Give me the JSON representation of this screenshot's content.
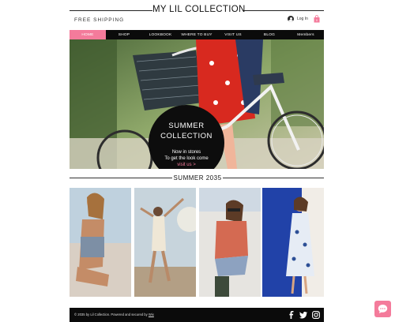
{
  "site": {
    "title": "MY LIL COLLECTION",
    "free_shipping": "FREE SHIPPING",
    "login_label": "Log In"
  },
  "nav": {
    "items": [
      "HOME",
      "SHOP",
      "LOOKBOOK",
      "WHERE TO BUY",
      "VISIT US",
      "BLOG",
      "Members"
    ]
  },
  "hero": {
    "title_line1": "SUMMER",
    "title_line2": "COLLECTION",
    "sub_line1": "Now in stores",
    "sub_line2": "To get the look come",
    "link": "visit us >"
  },
  "section": {
    "title": "SUMMER 2035"
  },
  "footer": {
    "copyright": "© 2035 by Lil Collection. Powered and secured by ",
    "wix": "Wix"
  },
  "colors": {
    "accent_pink": "#f47b9b",
    "nav_bg": "#0b0b0b",
    "footer_bg": "#0b0b0b"
  },
  "icons": [
    "avatar-icon",
    "cart-icon",
    "facebook-icon",
    "twitter-icon",
    "instagram-icon",
    "chat-icon"
  ]
}
